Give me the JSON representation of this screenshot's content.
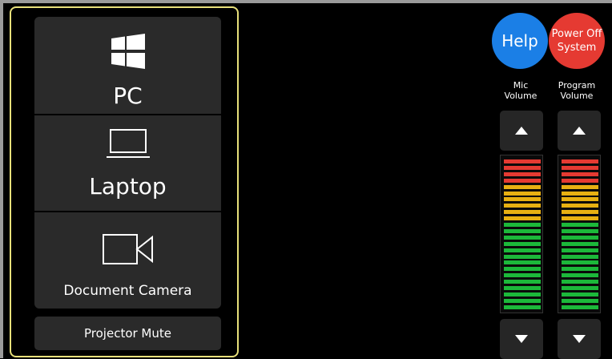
{
  "sources": {
    "pc": {
      "label": "PC",
      "icon": "windows-logo-icon"
    },
    "laptop": {
      "label": "Laptop",
      "icon": "laptop-icon"
    },
    "document_camera": {
      "label": "Document Camera",
      "icon": "video-camera-icon"
    },
    "projector_mute": {
      "label": "Projector Mute"
    }
  },
  "controls": {
    "help": {
      "label": "Help",
      "color": "#1b7fe6"
    },
    "power_off": {
      "line1": "Power Off",
      "line2": "System",
      "color": "#e53a32"
    }
  },
  "volume": {
    "mic": {
      "label_line1": "Mic",
      "label_line2": "Volume",
      "up_icon": "triangle-up-icon",
      "down_icon": "triangle-down-icon"
    },
    "program": {
      "label_line1": "Program",
      "label_line2": "Volume",
      "up_icon": "triangle-up-icon",
      "down_icon": "triangle-down-icon"
    }
  },
  "meter_colors": {
    "red": "#e53a32",
    "yellow": "#e8b012",
    "green": "#1cb83a"
  },
  "meter_segments": {
    "red": 4,
    "yellow": 6,
    "green": 14,
    "total": 24
  },
  "accent_border": "#e8e07a"
}
